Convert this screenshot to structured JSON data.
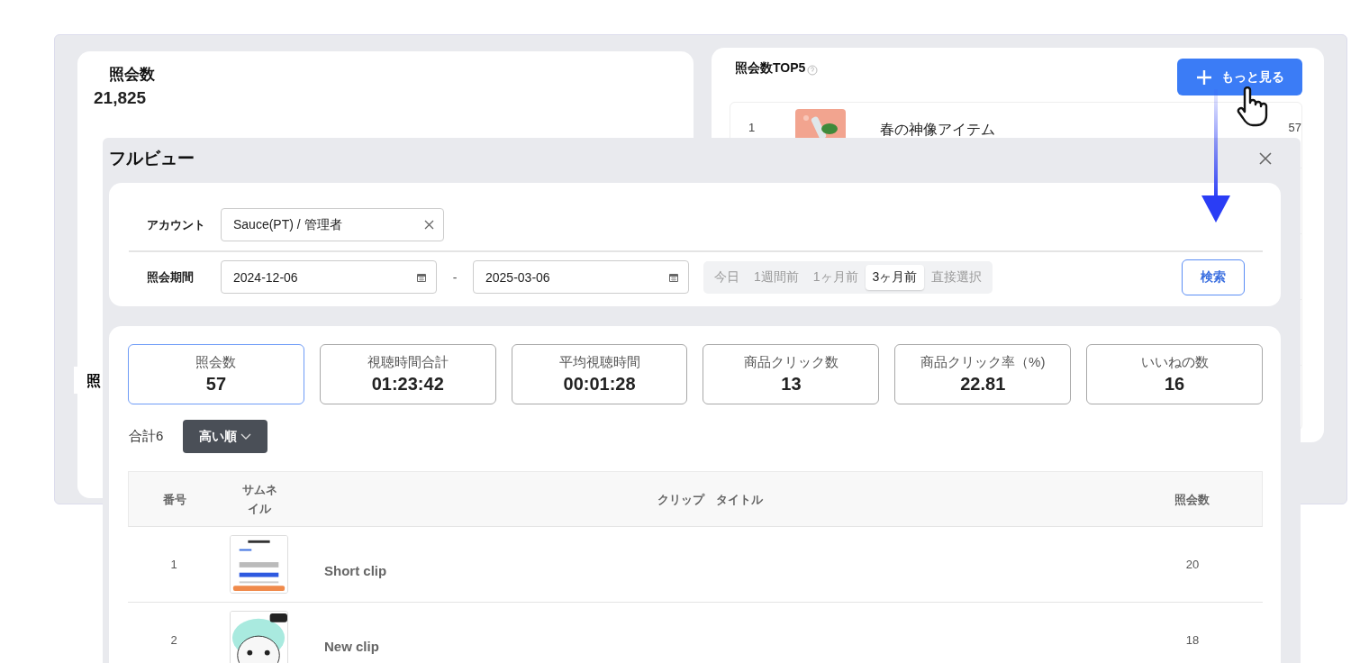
{
  "dashboard": {
    "views_card": {
      "title": "照会数",
      "total": "21,825",
      "section_label": "照"
    },
    "top5": {
      "title": "照会数TOP5",
      "more_button": "もっと見る",
      "items": [
        {
          "rank": "1",
          "title": "春の神像アイテム",
          "views": "57"
        }
      ]
    }
  },
  "modal": {
    "title": "フルビュー",
    "filters": {
      "account": {
        "label": "アカウント",
        "value": "Sauce(PT) / 管理者"
      },
      "period": {
        "label": "照会期間",
        "start": "2024-12-06",
        "separator": "-",
        "end": "2025-03-06",
        "presets": [
          {
            "label": "今日",
            "selected": false
          },
          {
            "label": "1週間前",
            "selected": false
          },
          {
            "label": "1ヶ月前",
            "selected": false
          },
          {
            "label": "3ヶ月前",
            "selected": true
          },
          {
            "label": "直接選択",
            "selected": false
          }
        ]
      },
      "search_button": "検索"
    },
    "metrics": [
      {
        "label": "照会数",
        "value": "57",
        "selected": true
      },
      {
        "label": "視聴時間合計",
        "value": "01:23:42",
        "selected": false
      },
      {
        "label": "平均視聴時間",
        "value": "00:01:28",
        "selected": false
      },
      {
        "label": "商品クリック数",
        "value": "13",
        "selected": false
      },
      {
        "label": "商品クリック率（%)",
        "value": "22.81",
        "selected": false
      },
      {
        "label": "いいねの数",
        "value": "16",
        "selected": false
      }
    ],
    "total": "合計6",
    "sort": "高い順",
    "table": {
      "columns": [
        "番号",
        "サムネイル",
        "クリップ　タイトル",
        "照会数"
      ],
      "rows": [
        {
          "number": "1",
          "title": "Short clip",
          "views": "20"
        },
        {
          "number": "2",
          "title": "New clip",
          "views": "18"
        }
      ]
    }
  }
}
